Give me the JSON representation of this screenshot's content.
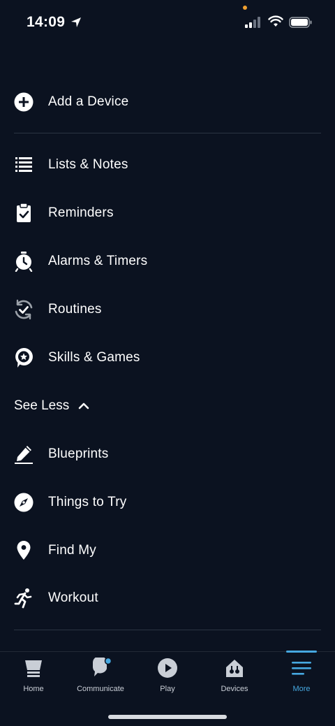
{
  "status_bar": {
    "time": "14:09"
  },
  "menu": {
    "add_device": "Add a Device",
    "lists_notes": "Lists & Notes",
    "reminders": "Reminders",
    "alarms_timers": "Alarms & Timers",
    "routines": "Routines",
    "skills_games": "Skills & Games",
    "see_less": "See Less",
    "blueprints": "Blueprints",
    "things_to_try": "Things to Try",
    "find_my": "Find My",
    "workout": "Workout"
  },
  "tabs": [
    {
      "label": "Home",
      "icon": "home-icon"
    },
    {
      "label": "Communicate",
      "icon": "chat-icon"
    },
    {
      "label": "Play",
      "icon": "play-icon"
    },
    {
      "label": "Devices",
      "icon": "devices-icon"
    },
    {
      "label": "More",
      "icon": "menu-icon",
      "active": true
    }
  ],
  "colors": {
    "background": "#0b1220",
    "accent": "#46a8e0",
    "notification_dot": "#f0a030"
  }
}
